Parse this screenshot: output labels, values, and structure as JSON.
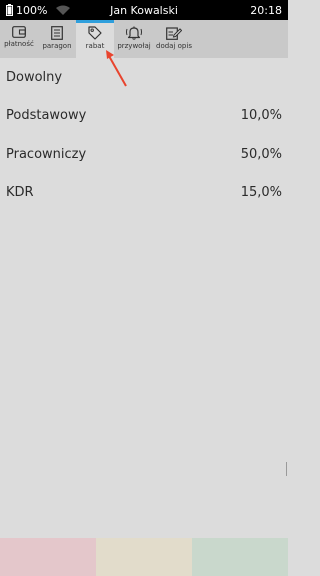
{
  "status_bar": {
    "battery": "100%",
    "user": "Jan Kowalski",
    "time": "20:18"
  },
  "toolbar": {
    "items": [
      {
        "label": "płatność",
        "icon": "wallet-icon"
      },
      {
        "label": "paragon",
        "icon": "receipt-icon"
      },
      {
        "label": "rabat",
        "icon": "tag-icon",
        "active": true
      },
      {
        "label": "przywołaj",
        "icon": "bell-icon"
      },
      {
        "label": "dodaj opis",
        "icon": "edit-note-icon"
      }
    ]
  },
  "discounts": [
    {
      "name": "Dowolny",
      "value": ""
    },
    {
      "name": "Podstawowy",
      "value": "10,0%"
    },
    {
      "name": "Pracowniczy",
      "value": "50,0%"
    },
    {
      "name": "KDR",
      "value": "15,0%"
    }
  ],
  "colors": {
    "accent": "#2f9fdc",
    "annotation": "#e8442e",
    "bottom_buttons": [
      "#e4c7cb",
      "#e2dccb",
      "#c9d8cc"
    ]
  }
}
